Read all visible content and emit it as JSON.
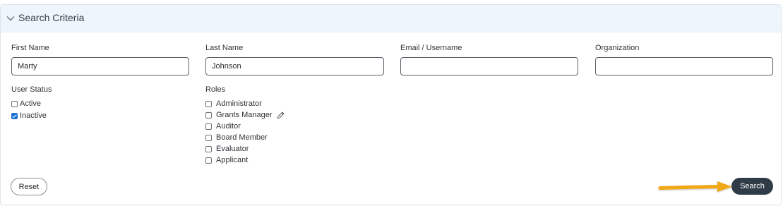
{
  "section": {
    "title": "Search Criteria",
    "icon": "chevron-down-icon"
  },
  "fields": {
    "first_name": {
      "label": "First Name",
      "value": "Marty"
    },
    "last_name": {
      "label": "Last Name",
      "value": "Johnson"
    },
    "email": {
      "label": "Email / Username",
      "value": ""
    },
    "organization": {
      "label": "Organization",
      "value": ""
    }
  },
  "user_status": {
    "label": "User Status",
    "options": [
      {
        "label": "Active",
        "checked": false
      },
      {
        "label": "Inactive",
        "checked": true
      }
    ]
  },
  "roles": {
    "label": "Roles",
    "edit_icon": "pencil-icon",
    "options": [
      {
        "label": "Administrator",
        "checked": false
      },
      {
        "label": "Grants Manager",
        "checked": false
      },
      {
        "label": "Auditor",
        "checked": false
      },
      {
        "label": "Board Member",
        "checked": false
      },
      {
        "label": "Evaluator",
        "checked": false
      },
      {
        "label": "Applicant",
        "checked": false
      }
    ]
  },
  "buttons": {
    "reset_label": "Reset",
    "search_label": "Search"
  },
  "colors": {
    "header_bg": "#eef5fd",
    "search_button": "#2f3b47",
    "checkbox_checked": "#1a6fd6",
    "arrow": "#f0a818"
  }
}
